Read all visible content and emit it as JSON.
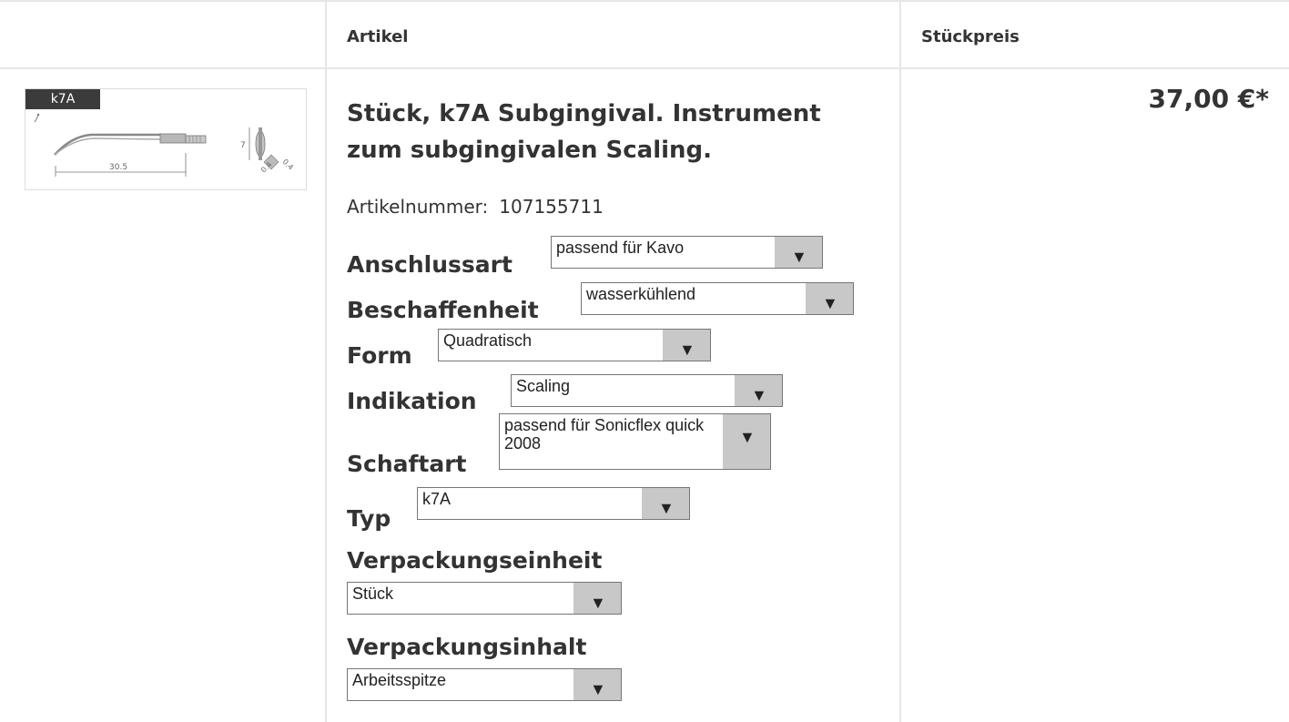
{
  "table": {
    "headers": [
      "",
      "Artikel",
      "Stückpreis"
    ]
  },
  "product": {
    "image_tag": "k7A",
    "image_dimension": "30.5",
    "image_dim_7": "7",
    "image_dim_04a": "0.4",
    "image_dim_04b": "0.4",
    "title": "Stück, k7A Subgingival. Instrument zum subgingivalen Scaling.",
    "article_number_label": "Artikelnummer:",
    "article_number": "107155711",
    "price": "37,00 €*"
  },
  "options": [
    {
      "label": "Anschlussart",
      "value": "passend für Kavo",
      "icon": "chevron-down-icon"
    },
    {
      "label": "Beschaffenheit",
      "value": "wasserkühlend",
      "icon": "chevron-down-icon"
    },
    {
      "label": "Form",
      "value": "Quadratisch",
      "icon": "chevron-down-icon"
    },
    {
      "label": "Indikation",
      "value": "Scaling",
      "icon": "chevron-down-icon"
    },
    {
      "label": "Schaftart",
      "value": "passend für Sonicflex quick 2008",
      "icon": "chevron-down-icon"
    },
    {
      "label": "Typ",
      "value": "k7A",
      "icon": "chevron-down-icon"
    },
    {
      "label": "Verpackungseinheit",
      "value": "Stück",
      "icon": "chevron-down-icon"
    },
    {
      "label": "Verpackungsinhalt",
      "value": "Arbeitsspitze",
      "icon": "chevron-down-icon"
    }
  ],
  "arrow_glyph": "▼"
}
